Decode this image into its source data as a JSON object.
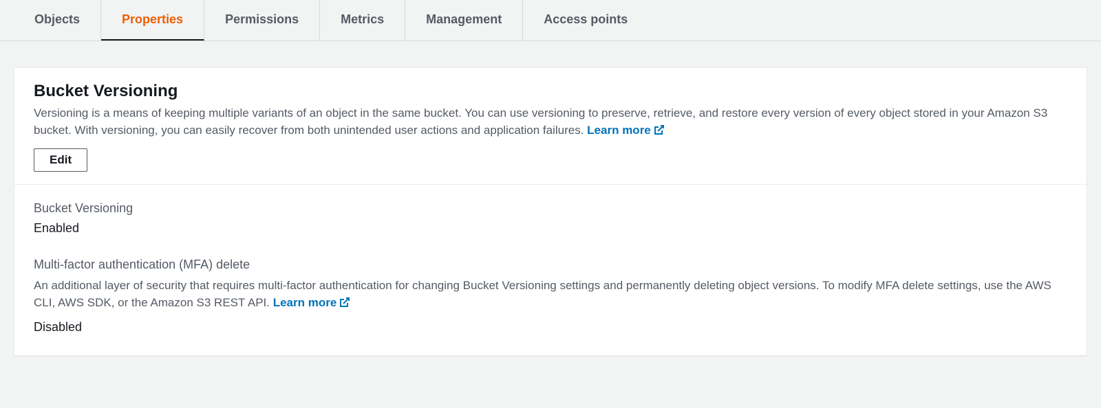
{
  "tabs": {
    "objects": "Objects",
    "properties": "Properties",
    "permissions": "Permissions",
    "metrics": "Metrics",
    "management": "Management",
    "access_points": "Access points"
  },
  "panel": {
    "title": "Bucket Versioning",
    "description": "Versioning is a means of keeping multiple variants of an object in the same bucket. You can use versioning to preserve, retrieve, and restore every version of every object stored in your Amazon S3 bucket. With versioning, you can easily recover from both unintended user actions and application failures. ",
    "learn_more": "Learn more",
    "edit": "Edit"
  },
  "versioning": {
    "label": "Bucket Versioning",
    "value": "Enabled"
  },
  "mfa": {
    "label": "Multi-factor authentication (MFA) delete",
    "description": "An additional layer of security that requires multi-factor authentication for changing Bucket Versioning settings and permanently deleting object versions. To modify MFA delete settings, use the AWS CLI, AWS SDK, or the Amazon S3 REST API. ",
    "learn_more": "Learn more",
    "value": "Disabled"
  }
}
